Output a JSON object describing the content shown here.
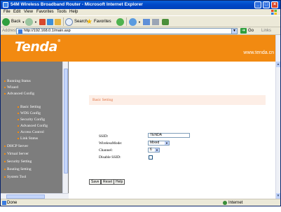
{
  "window": {
    "title": "54M Wireless Broadband Router - Microsoft Internet Explorer",
    "buttons": [
      "_",
      "□",
      "×"
    ]
  },
  "menu": [
    "File",
    "Edit",
    "View",
    "Favorites",
    "Tools",
    "Help"
  ],
  "toolbar": {
    "back_label": "Back",
    "search_label": "Search",
    "favorites_label": "Favorites"
  },
  "address": {
    "label": "Address",
    "url": "http://192.168.0.1/main.asp",
    "go_label": "Go",
    "links_label": "Links"
  },
  "banner": {
    "logo": "Tenda",
    "url": "www.tenda.cn"
  },
  "nav": {
    "items": [
      "Running Status",
      "Wizard",
      "Advanced Config"
    ],
    "sub_items": [
      "Basic Setting",
      "WDS Config",
      "Security Config",
      "Advanced Config",
      "Access Control",
      "Link Status"
    ],
    "items_after": [
      "DHCP Server",
      "Virtual Server",
      "Security Setting",
      "Routing Setting",
      "System Tool"
    ]
  },
  "form": {
    "section_title": "Basic Setting",
    "ssid_label": "SSID:",
    "ssid_value": "TENDA",
    "mode_label": "WirelessMode:",
    "mode_value": "Mixed",
    "channel_label": "Channel:",
    "channel_value": "6",
    "disable_ssid_label": "Disable SSID:",
    "disable_ssid_checked": false
  },
  "buttons": {
    "save": "Save",
    "reset": "Reset",
    "help": "Help"
  },
  "status": {
    "left": "Done",
    "zone": "Internet"
  }
}
